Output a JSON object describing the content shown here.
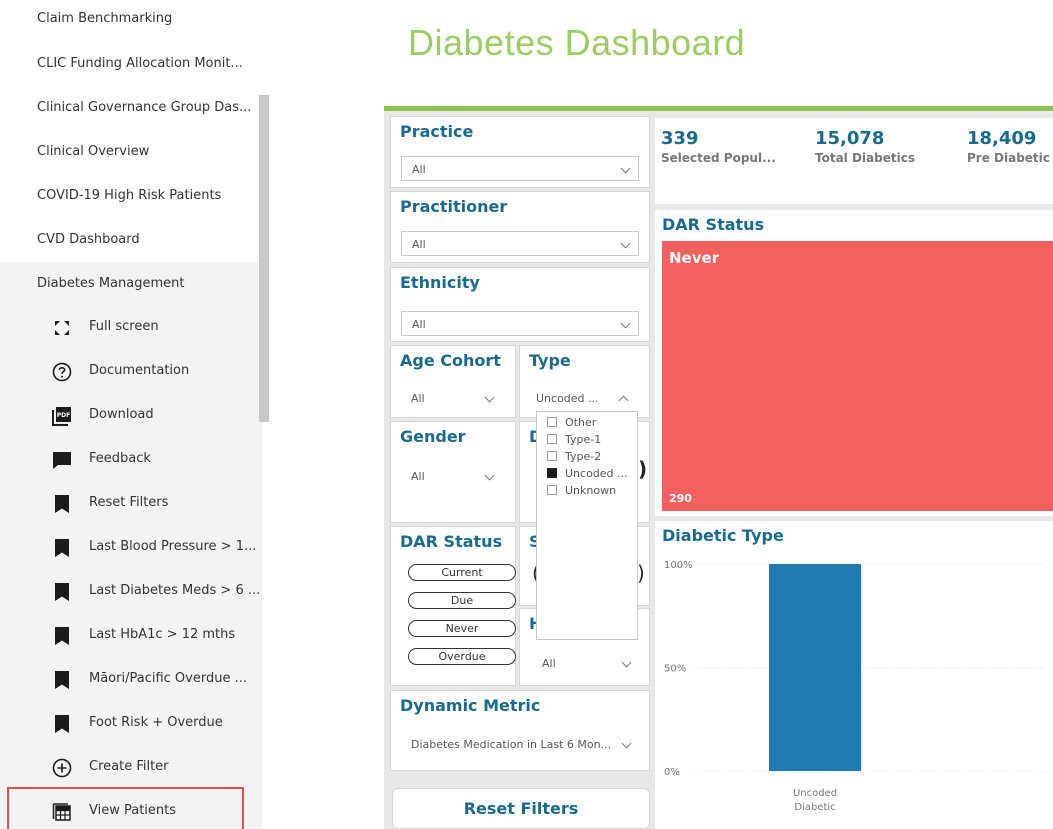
{
  "nav": {
    "top_items": [
      "Claim Benchmarking",
      "CLIC Funding Allocation Monit...",
      "Clinical Governance Group Das...",
      "Clinical Overview",
      "COVID-19 High Risk Patients",
      "CVD Dashboard",
      "Diabetes Management"
    ],
    "sub_items": [
      {
        "label": "Full screen",
        "icon": "full-screen-icon"
      },
      {
        "label": "Documentation",
        "icon": "help-circle-icon"
      },
      {
        "label": "Download",
        "icon": "pdf-icon"
      },
      {
        "label": "Feedback",
        "icon": "chat-icon"
      },
      {
        "label": "Reset Filters",
        "icon": "bookmark-icon"
      },
      {
        "label": "Last Blood Pressure > 1...",
        "icon": "bookmark-icon"
      },
      {
        "label": "Last Diabetes Meds > 6 ...",
        "icon": "bookmark-icon"
      },
      {
        "label": "Last HbA1c > 12 mths",
        "icon": "bookmark-icon"
      },
      {
        "label": "Māori/Pacific Overdue ...",
        "icon": "bookmark-icon"
      },
      {
        "label": "Foot Risk + Overdue",
        "icon": "bookmark-icon"
      },
      {
        "label": "Create Filter",
        "icon": "plus-circle-icon"
      },
      {
        "label": "View Patients",
        "icon": "table-icon"
      }
    ]
  },
  "dashboard": {
    "title": "Diabetes Dashboard",
    "accent_color": "#9ccc65",
    "heading_color": "#1b6a8c"
  },
  "slicers": {
    "practice": {
      "title": "Practice",
      "value": "All"
    },
    "practitioner": {
      "title": "Practitioner",
      "value": "All"
    },
    "ethnicity": {
      "title": "Ethnicity",
      "value": "All"
    },
    "age_cohort": {
      "title": "Age Cohort",
      "value": "All"
    },
    "type": {
      "title": "Type",
      "value": "Uncoded ...",
      "options": [
        "Other",
        "Type-1",
        "Type-2",
        "Uncoded ...",
        "Unknown"
      ],
      "checked": "Uncoded ..."
    },
    "gender": {
      "title": "Gender",
      "value": "All"
    },
    "dar_status": {
      "title": "DAR Status",
      "pills": [
        "Current",
        "Due",
        "Never",
        "Overdue"
      ]
    },
    "hidden_h": {
      "value": "All"
    },
    "dynamic_metric": {
      "title": "Dynamic Metric",
      "value": "Diabetes Medication in Last 6 Mon..."
    },
    "partial_d": "D",
    "partial_s": "S",
    "partial_h": "H",
    "partial_paren_left": "(",
    "partial_paren_right": ")"
  },
  "kpis": [
    {
      "value": "339",
      "label": "Selected Popul..."
    },
    {
      "value": "15,078",
      "label": "Total Diabetics"
    },
    {
      "value": "18,409",
      "label": "Pre Diabetic"
    }
  ],
  "dar_visual": {
    "title": "DAR Status",
    "tile_label": "Never",
    "tile_count": "290",
    "tile_color": "#f26160"
  },
  "reset_button": "Reset Filters",
  "chart_data": {
    "type": "bar",
    "title": "Diabetic Type",
    "categories": [
      "Uncoded Diabetic"
    ],
    "category_lines": [
      [
        "Uncoded",
        "Diabetic"
      ]
    ],
    "values": [
      100
    ],
    "y_tick_labels": [
      "100%",
      "50%",
      "0%"
    ],
    "ylim": [
      0,
      100
    ],
    "bar_color": "#1f7bb0",
    "grid": true
  }
}
